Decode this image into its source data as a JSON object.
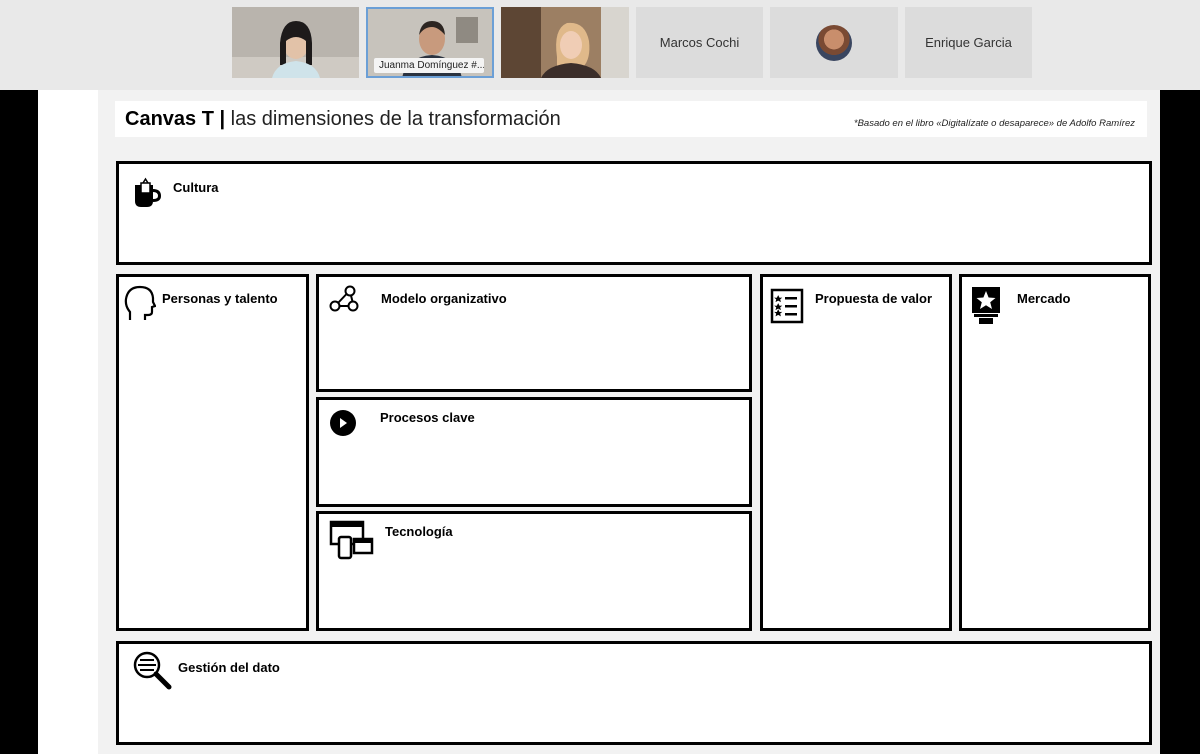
{
  "participants": [
    {
      "name": "",
      "video": true
    },
    {
      "name": "Juanma Domínguez #...",
      "video": true,
      "active": true
    },
    {
      "name": "",
      "video": true
    },
    {
      "name": "Marcos Cochi",
      "video": false
    },
    {
      "name": "",
      "video": false,
      "avatar": true
    },
    {
      "name": "Enrique Garcia",
      "video": false
    }
  ],
  "slide": {
    "title_bold": "Canvas T |",
    "title_rest": " las dimensiones de la transformación",
    "credit": "*Basado en el libro «Digitalízate o desaparece» de Adolfo Ramírez",
    "sections": {
      "cultura": "Cultura",
      "personas": "Personas y talento",
      "modelo": "Modelo organizativo",
      "procesos": "Procesos clave",
      "tecnologia": "Tecnología",
      "propuesta": "Propuesta de valor",
      "mercado": "Mercado",
      "gestion": "Gestión del dato"
    }
  }
}
